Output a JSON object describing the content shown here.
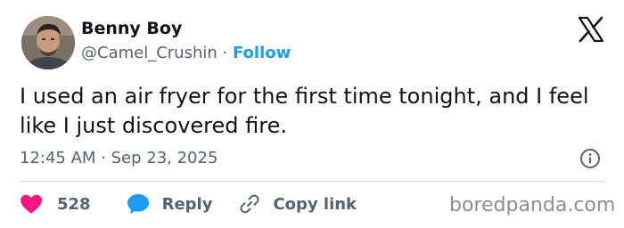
{
  "author": {
    "name": "Benny Boy",
    "handle": "@Camel_Crushin",
    "separator": "·",
    "follow_label": "Follow",
    "avatar_icon": "profile-photo"
  },
  "tweet": {
    "text": "I used an air fryer for the first time tonight, and I feel like I just discovered fire.",
    "timestamp": "12:45 AM · Sep 23, 2025"
  },
  "actions": {
    "likes_count": "528",
    "reply_label": "Reply",
    "copy_link_label": "Copy link"
  },
  "icons": {
    "platform_logo": "x-logo-icon",
    "info": "info-icon",
    "like": "heart-icon",
    "reply": "speech-bubble-icon",
    "copy": "link-icon"
  },
  "colors": {
    "accent": "#1d9bf0",
    "like": "#f91880",
    "text_primary": "#0f1419",
    "text_secondary": "#536471"
  },
  "watermark": "boredpanda.com"
}
